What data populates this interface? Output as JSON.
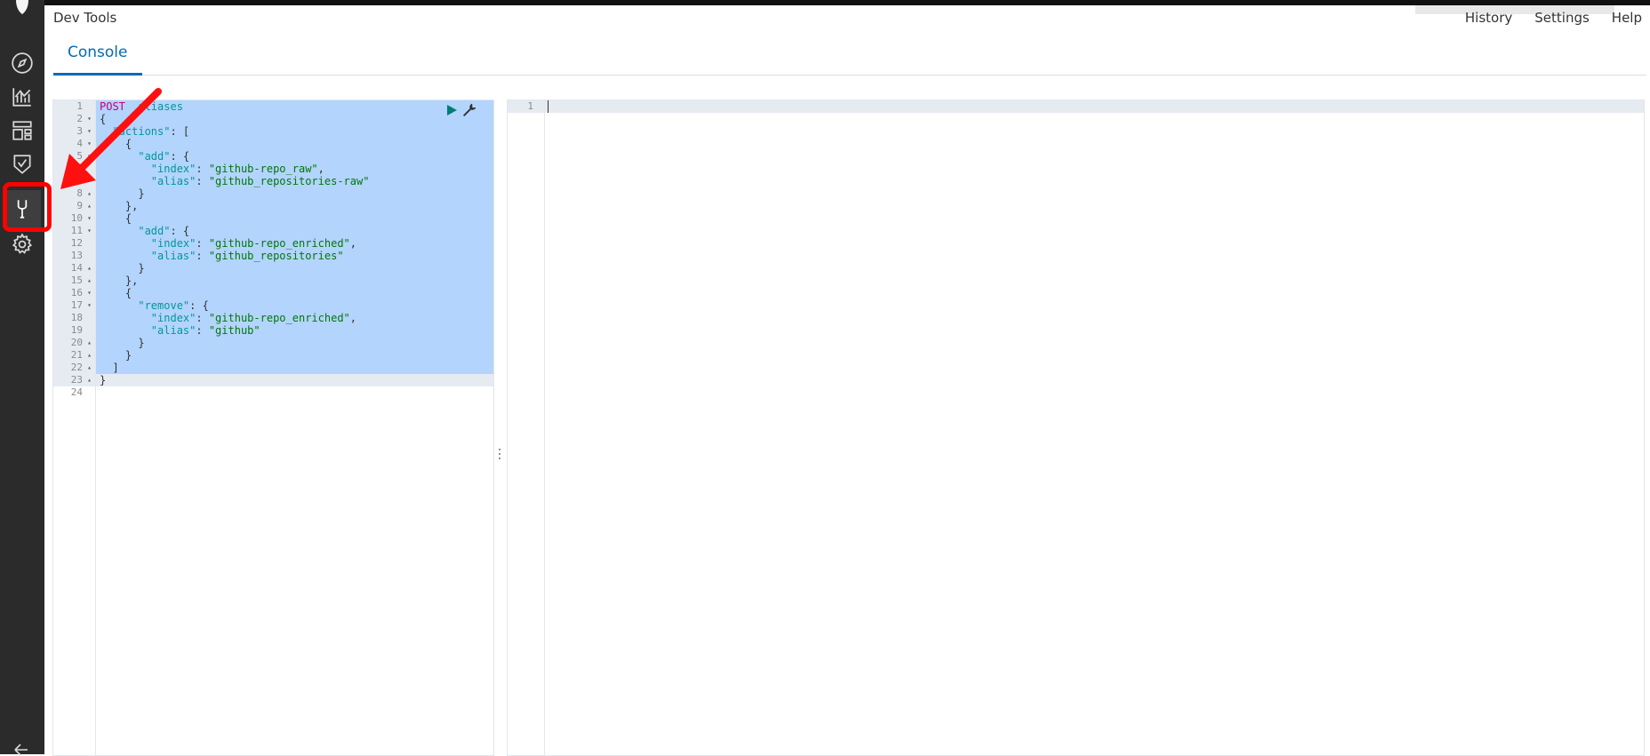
{
  "app": {
    "title": "Dev Tools"
  },
  "top_links": [
    "History",
    "Settings",
    "Help"
  ],
  "tabs": [
    {
      "label": "Console"
    }
  ],
  "sidebar": {
    "items": [
      {
        "icon": "compass-icon"
      },
      {
        "icon": "chart-icon"
      },
      {
        "icon": "dashboard-icon"
      },
      {
        "icon": "timelion-shield-icon"
      },
      {
        "icon": "wrench-icon",
        "active": true
      },
      {
        "icon": "gear-icon"
      }
    ]
  },
  "editor": {
    "line_numbers": [
      "1",
      "2",
      "3",
      "4",
      "5",
      "6",
      "7",
      "8",
      "9",
      "10",
      "11",
      "12",
      "13",
      "14",
      "15",
      "16",
      "17",
      "18",
      "19",
      "20",
      "21",
      "22",
      "23",
      "24"
    ],
    "lines": [
      [
        {
          "t": "POST",
          "c": "kw"
        },
        {
          "t": " _aliases",
          "c": "url"
        }
      ],
      [
        {
          "t": "{",
          "c": ""
        }
      ],
      [
        {
          "t": "  ",
          "c": ""
        },
        {
          "t": "\"actions\"",
          "c": "key"
        },
        {
          "t": ": [",
          "c": ""
        }
      ],
      [
        {
          "t": "    {",
          "c": ""
        }
      ],
      [
        {
          "t": "      ",
          "c": ""
        },
        {
          "t": "\"add\"",
          "c": "key"
        },
        {
          "t": ": {",
          "c": ""
        }
      ],
      [
        {
          "t": "        ",
          "c": ""
        },
        {
          "t": "\"index\"",
          "c": "key"
        },
        {
          "t": ": ",
          "c": ""
        },
        {
          "t": "\"github-repo_raw\"",
          "c": "str"
        },
        {
          "t": ",",
          "c": ""
        }
      ],
      [
        {
          "t": "        ",
          "c": ""
        },
        {
          "t": "\"alias\"",
          "c": "key"
        },
        {
          "t": ": ",
          "c": ""
        },
        {
          "t": "\"github_repositories-raw\"",
          "c": "str"
        }
      ],
      [
        {
          "t": "      }",
          "c": ""
        }
      ],
      [
        {
          "t": "    },",
          "c": ""
        }
      ],
      [
        {
          "t": "    {",
          "c": ""
        }
      ],
      [
        {
          "t": "      ",
          "c": ""
        },
        {
          "t": "\"add\"",
          "c": "key"
        },
        {
          "t": ": {",
          "c": ""
        }
      ],
      [
        {
          "t": "        ",
          "c": ""
        },
        {
          "t": "\"index\"",
          "c": "key"
        },
        {
          "t": ": ",
          "c": ""
        },
        {
          "t": "\"github-repo_enriched\"",
          "c": "str"
        },
        {
          "t": ",",
          "c": ""
        }
      ],
      [
        {
          "t": "        ",
          "c": ""
        },
        {
          "t": "\"alias\"",
          "c": "key"
        },
        {
          "t": ": ",
          "c": ""
        },
        {
          "t": "\"github_repositories\"",
          "c": "str"
        }
      ],
      [
        {
          "t": "      }",
          "c": ""
        }
      ],
      [
        {
          "t": "    },",
          "c": ""
        }
      ],
      [
        {
          "t": "    {",
          "c": ""
        }
      ],
      [
        {
          "t": "      ",
          "c": ""
        },
        {
          "t": "\"remove\"",
          "c": "key"
        },
        {
          "t": ": {",
          "c": ""
        }
      ],
      [
        {
          "t": "        ",
          "c": ""
        },
        {
          "t": "\"index\"",
          "c": "key"
        },
        {
          "t": ": ",
          "c": ""
        },
        {
          "t": "\"github-repo_enriched\"",
          "c": "str"
        },
        {
          "t": ",",
          "c": ""
        }
      ],
      [
        {
          "t": "        ",
          "c": ""
        },
        {
          "t": "\"alias\"",
          "c": "key"
        },
        {
          "t": ": ",
          "c": ""
        },
        {
          "t": "\"github\"",
          "c": "str"
        }
      ],
      [
        {
          "t": "      }",
          "c": ""
        }
      ],
      [
        {
          "t": "    }",
          "c": ""
        }
      ],
      [
        {
          "t": "  ]",
          "c": ""
        }
      ],
      [
        {
          "t": "}",
          "c": ""
        }
      ],
      [
        {
          "t": "",
          "c": ""
        }
      ]
    ],
    "folds": [
      "",
      "▾",
      "▾",
      "▾",
      "▾",
      "",
      "",
      "▴",
      "▴",
      "▾",
      "▾",
      "",
      "",
      "▴",
      "▴",
      "▾",
      "▾",
      "",
      "",
      "▴",
      "▴",
      "▴",
      "▴",
      ""
    ]
  },
  "output": {
    "line_numbers": [
      "1"
    ]
  },
  "colors": {
    "accent": "#006bb4",
    "annotation": "#ff0000",
    "sidebar": "#2b2b2b"
  }
}
